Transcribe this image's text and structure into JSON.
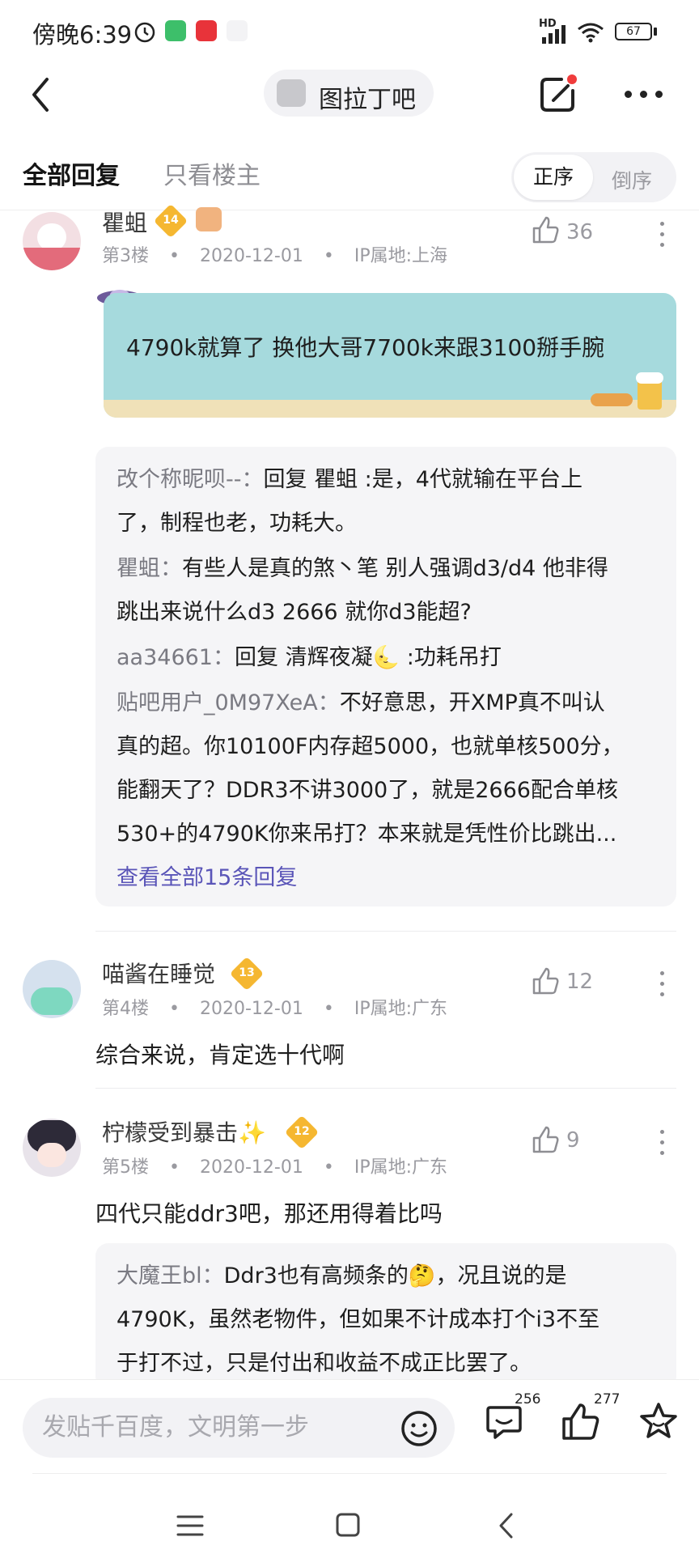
{
  "status_bar": {
    "time": "傍晚6:39",
    "battery": "67",
    "network": "HD"
  },
  "header": {
    "forum_name": "图拉丁吧"
  },
  "tabs": {
    "all_replies": "全部回复",
    "op_only": "只看楼主",
    "order_asc": "正序",
    "order_desc": "倒序"
  },
  "posts": [
    {
      "username": "瞿蛆",
      "level": "14",
      "floor": "第3楼",
      "date": "2020-12-01",
      "ip": "IP属地:上海",
      "likes": "36",
      "text": "4790k就算了 换他大哥7700k来跟3100掰手腕",
      "replies": [
        {
          "name": "改个称昵呗--：",
          "lines": [
            "回复 瞿蛆 :是，4代就输在平台上",
            "了，制程也老，功耗大。"
          ]
        },
        {
          "name": "瞿蛆：",
          "lines": [
            "有些人是真的煞丶笔 别人强调d3/d4 他非得",
            "跳出来说什么d3 2666 就你d3能超?"
          ]
        },
        {
          "name": "aa34661：",
          "lines": [
            "回复 清辉夜凝🌜 :功耗吊打"
          ]
        },
        {
          "name": "贴吧用户_0M97XeA：",
          "lines": [
            "不好意思，开XMP真不叫认",
            "真的超。你10100F内存超5000，也就单核500分，",
            "能翻天了？DDR3不讲3000了，就是2666配合单核",
            "530+的4790K你来吊打？本来就是凭性价比跳出..."
          ]
        }
      ],
      "view_all": "查看全部15条回复"
    },
    {
      "username": "喵酱在睡觉",
      "level": "13",
      "floor": "第4楼",
      "date": "2020-12-01",
      "ip": "IP属地:广东",
      "likes": "12",
      "text": "综合来说，肯定选十代啊"
    },
    {
      "username": "柠檬受到暴击✨",
      "level": "12",
      "floor": "第5楼",
      "date": "2020-12-01",
      "ip": "IP属地:广东",
      "likes": "9",
      "text": "四代只能ddr3吧，那还用得着比吗",
      "replies": [
        {
          "name": "大魔王bl：",
          "lines": [
            "Ddr3也有高频条的🤔，况且说的是",
            "4790K，虽然老物件，但如果不计成本打个i3不至",
            "于打不过，只是付出和收益不成正比罢了。"
          ]
        }
      ]
    }
  ],
  "meta_separator": "•",
  "bottom_bar": {
    "compose_placeholder": "发贴千百度，文明第一步",
    "comments_count": "256",
    "likes_count": "277"
  },
  "colors": {
    "accent_link": "#5a55b8",
    "badge_gold": "#f5b731",
    "notify_red": "#f03c3c"
  }
}
